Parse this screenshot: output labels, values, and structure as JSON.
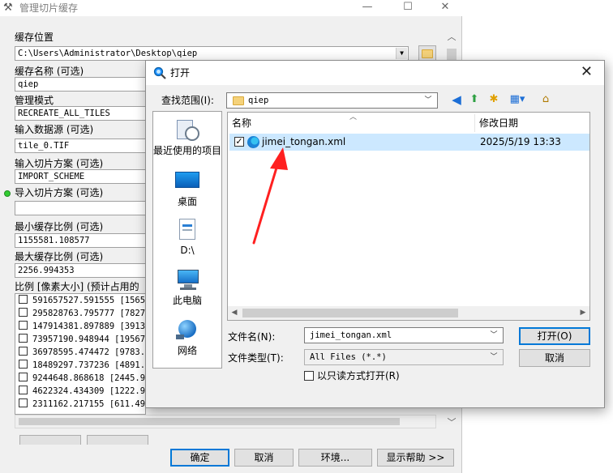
{
  "bg_window": {
    "title": "管理切片缓存",
    "controls": {
      "minimize": "—",
      "maximize": "☐",
      "close": "✕"
    },
    "fields": {
      "cache_location_label": "缓存位置",
      "cache_location_value": "C:\\Users\\Administrator\\Desktop\\qiep",
      "cache_name_label": "缓存名称 (可选)",
      "cache_name_value": "qiep",
      "manage_mode_label": "管理模式",
      "manage_mode_value": "RECREATE_ALL_TILES",
      "input_source_label": "输入数据源 (可选)",
      "input_source_value": "tile_0.TIF",
      "input_scheme_label": "输入切片方案 (可选)",
      "input_scheme_value": "IMPORT_SCHEME",
      "import_scheme_label": "导入切片方案 (可选)",
      "import_scheme_value": "",
      "min_scale_label": "最小缓存比例 (可选)",
      "min_scale_value": "1155581.108577",
      "max_scale_label": "最大缓存比例 (可选)",
      "max_scale_value": "2256.994353",
      "scales_label": "比例 [像素大小] (预计占用的"
    },
    "scale_list": [
      "591657527.591555 [15654",
      "295828763.795777 [78271",
      "147914381.897889 [39135",
      "73957190.948944 [19567.",
      "36978595.474472 [9783.9",
      "18489297.737236 [4891.9",
      "9244648.868618 [2445.98",
      "4622324.434309 [1222.99",
      "2311162.217155 [611.496"
    ],
    "buttons": {
      "ok": "确定",
      "cancel": "取消",
      "env": "环境...",
      "help": "显示帮助 >>"
    }
  },
  "dialog": {
    "title": "打开",
    "look_in_label": "查找范围(I):",
    "look_in_value": "qiep",
    "places": [
      {
        "label": "最近使用的项目",
        "icon": "recent-icon"
      },
      {
        "label": "桌面",
        "icon": "desktop-icon"
      },
      {
        "label": "D:\\",
        "icon": "drive-icon"
      },
      {
        "label": "此电脑",
        "icon": "computer-icon"
      },
      {
        "label": "网络",
        "icon": "network-icon"
      }
    ],
    "columns": {
      "name": "名称",
      "modified": "修改日期"
    },
    "files": [
      {
        "name": "jimei_tongan.xml",
        "modified": "2025/5/19 13:33",
        "checked": true
      }
    ],
    "filename_label": "文件名(N):",
    "filename_value": "jimei_tongan.xml",
    "filetype_label": "文件类型(T):",
    "filetype_value": "All Files (*.*)",
    "readonly_label": "以只读方式打开(R)",
    "open_button": "打开(O)",
    "cancel_button": "取消"
  },
  "colors": {
    "selection": "#cce8ff",
    "accent": "#0078d7",
    "annotation": "#ff2020"
  }
}
